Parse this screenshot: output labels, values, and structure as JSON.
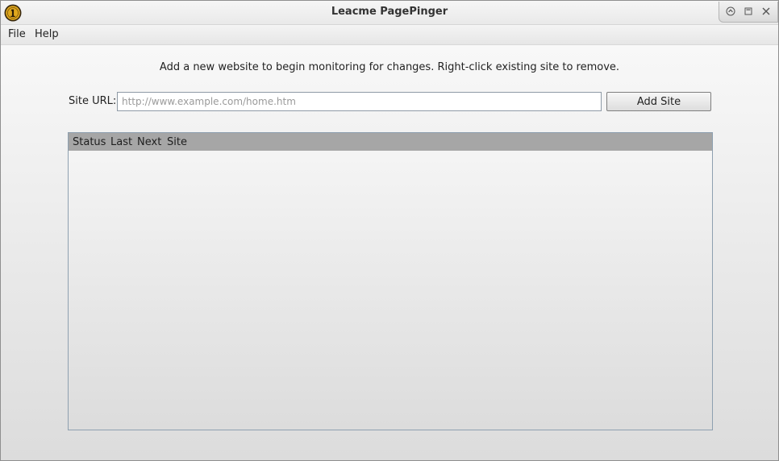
{
  "window": {
    "title": "Leacme PagePinger"
  },
  "menu": {
    "items": [
      {
        "label": "File"
      },
      {
        "label": "Help"
      }
    ]
  },
  "main": {
    "instruction": "Add a new website to begin monitoring for changes. Right-click existing site to remove.",
    "url_label": "Site URL:",
    "url_input": {
      "value": "",
      "placeholder": "http://www.example.com/home.htm"
    },
    "add_button_label": "Add Site"
  },
  "table": {
    "columns": [
      "Status",
      "Last",
      "Next",
      "Site"
    ],
    "rows": []
  },
  "icons": {
    "app": "app-logo-icon",
    "window_controls": [
      "minimize-icon",
      "maximize-icon",
      "close-icon"
    ]
  },
  "colors": {
    "app_icon_gold": "#e0a81c",
    "table_header": "#a6a6a6"
  }
}
